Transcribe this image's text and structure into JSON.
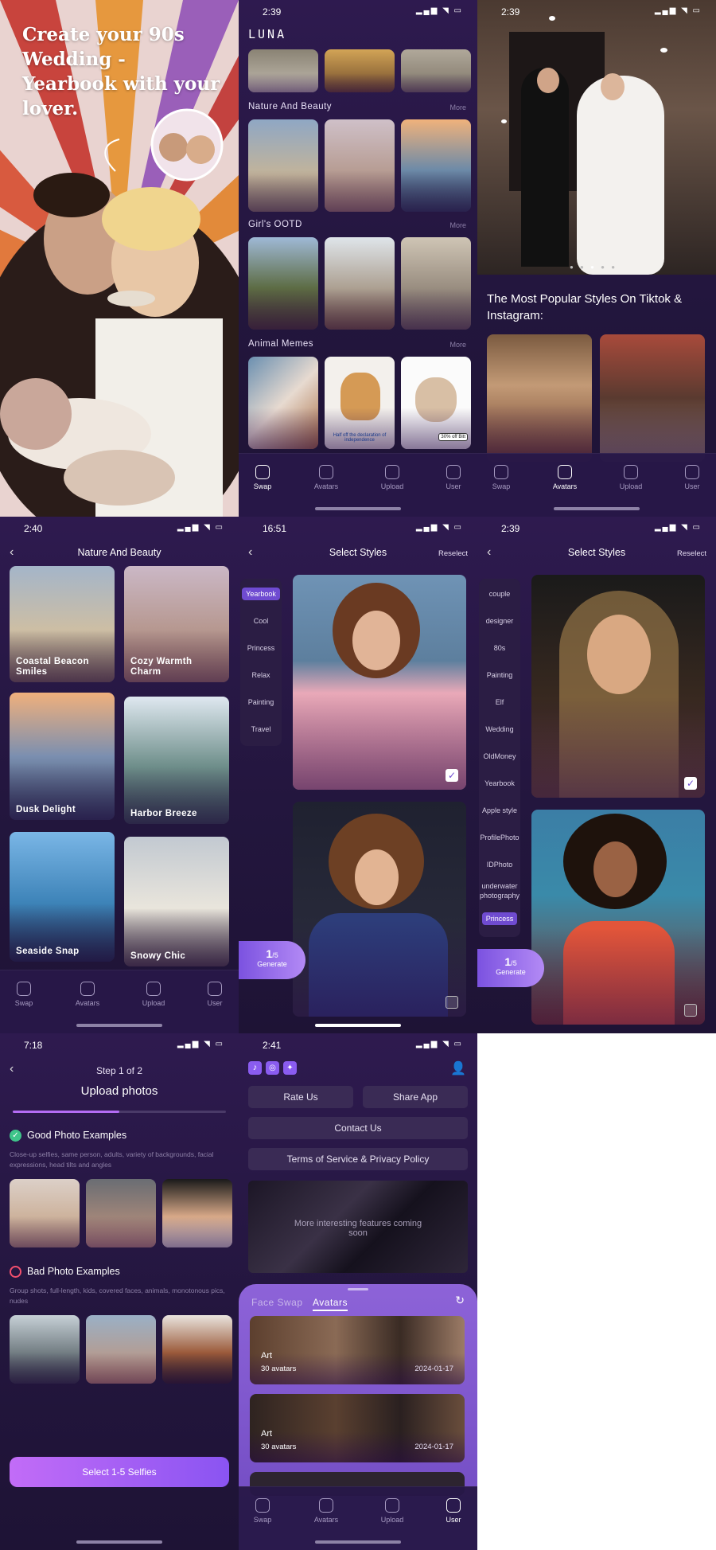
{
  "promo": {
    "headline": "Create your 90s Wedding - Yearbook with your lover."
  },
  "home": {
    "time": "2:39",
    "logo": "LUNA",
    "sections": [
      {
        "title": "Nature And Beauty",
        "more": "More"
      },
      {
        "title": "Girl's OOTD",
        "more": "More"
      },
      {
        "title": "Animal Memes",
        "more": "More"
      }
    ],
    "meme_text": "Half off the declaration of independence",
    "meme_badge": "30% off Bitt"
  },
  "tabs": {
    "swap": "Swap",
    "avatars": "Avatars",
    "upload": "Upload",
    "user": "User"
  },
  "feature": {
    "time": "2:39",
    "title": "The Most Popular Styles On Tiktok & Instagram:"
  },
  "nature": {
    "time": "2:40",
    "title": "Nature And Beauty",
    "items": [
      "Coastal Beacon Smiles",
      "Cozy Warmth Charm",
      "Dusk Delight",
      "Harbor Breeze",
      "Seaside Snap",
      "Snowy Chic"
    ]
  },
  "styles1": {
    "time": "16:51",
    "title": "Select Styles",
    "reselect": "Reselect",
    "categories": [
      "Yearbook",
      "Cool",
      "Princess",
      "Relax",
      "Painting",
      "Travel"
    ],
    "selected": "Yearbook",
    "count": "1",
    "total": "/5",
    "generate": "Generate"
  },
  "styles2": {
    "time": "2:39",
    "title": "Select Styles",
    "reselect": "Reselect",
    "categories": [
      "couple",
      "designer",
      "80s",
      "Painting",
      "Elf",
      "Wedding",
      "OldMoney",
      "Yearbook",
      "Apple style",
      "ProfilePhoto",
      "IDPhoto",
      "underwater photography",
      "Princess"
    ],
    "selected": "Princess",
    "count": "1",
    "total": "/5",
    "generate": "Generate"
  },
  "upload": {
    "time": "7:18",
    "step": "Step 1 of 2",
    "title": "Upload photos",
    "progress": 0.5,
    "good_title": "Good Photo Examples",
    "good_desc": "Close-up selfies, same person, adults, variety of backgrounds, facial expressions, head tilts and angles",
    "bad_title": "Bad Photo Examples",
    "bad_desc": "Group shots, full-length, kids, covered faces, animals, monotonous pics, nudes",
    "cta": "Select 1-5 Selfies"
  },
  "user": {
    "time": "2:41",
    "rate": "Rate Us",
    "share": "Share App",
    "contact": "Contact Us",
    "terms": "Terms of Service & Privacy Policy",
    "coming": "More interesting features coming soon",
    "tab_face": "Face Swap",
    "tab_avatars": "Avatars",
    "cards": [
      {
        "title": "Art",
        "count": "30 avatars",
        "date": "2024-01-17"
      },
      {
        "title": "Art",
        "count": "30 avatars",
        "date": "2024-01-17"
      }
    ]
  },
  "colors": {
    "accent": "#7b52e0",
    "bg": "#2a1a48",
    "gradient_btn": "#b263f5"
  }
}
